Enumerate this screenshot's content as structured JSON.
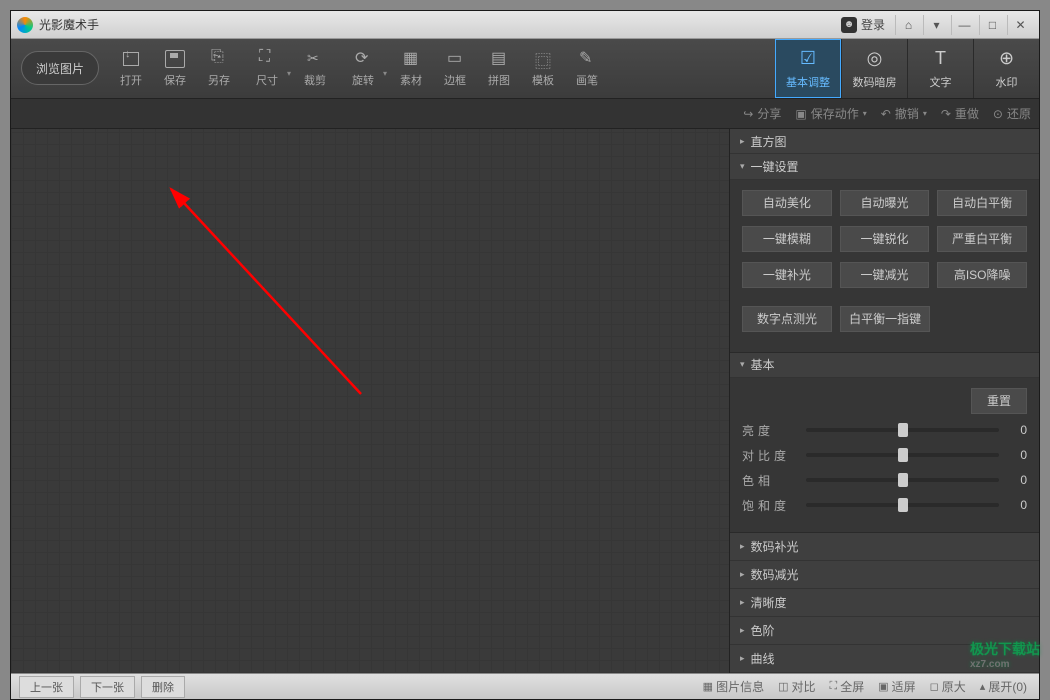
{
  "app": {
    "title": "光影魔术手"
  },
  "titlebar": {
    "login": "登录"
  },
  "toolbar": {
    "browse": "浏览图片",
    "items": [
      {
        "label": "打开",
        "icon": "open"
      },
      {
        "label": "保存",
        "icon": "save"
      },
      {
        "label": "另存",
        "icon": "saveas"
      },
      {
        "label": "尺寸",
        "icon": "size",
        "dd": true
      },
      {
        "label": "裁剪",
        "icon": "crop"
      },
      {
        "label": "旋转",
        "icon": "rotate",
        "dd": true
      },
      {
        "label": "素材",
        "icon": "material"
      },
      {
        "label": "边框",
        "icon": "border"
      },
      {
        "label": "拼图",
        "icon": "collage"
      },
      {
        "label": "模板",
        "icon": "template"
      },
      {
        "label": "画笔",
        "icon": "brush"
      }
    ]
  },
  "primary_tabs": [
    {
      "label": "基本调整",
      "icon": "☑",
      "active": true
    },
    {
      "label": "数码暗房",
      "icon": "◎"
    },
    {
      "label": "文字",
      "icon": "T"
    },
    {
      "label": "水印",
      "icon": "⊕"
    }
  ],
  "subtoolbar": {
    "share": "分享",
    "save_action": "保存动作",
    "undo": "撤销",
    "redo": "重做",
    "restore": "还原"
  },
  "right_panel": {
    "histogram": {
      "title": "直方图"
    },
    "one_click": {
      "title": "一键设置",
      "buttons_row1": [
        "自动美化",
        "自动曝光",
        "自动白平衡"
      ],
      "buttons_row2": [
        "一键模糊",
        "一键锐化",
        "严重白平衡"
      ],
      "buttons_row3": [
        "一键补光",
        "一键减光",
        "高ISO降噪"
      ],
      "buttons_row4": [
        "数字点测光",
        "白平衡一指键"
      ]
    },
    "basic": {
      "title": "基本",
      "reset": "重置",
      "sliders": [
        {
          "label": "亮度",
          "value": "0"
        },
        {
          "label": "对比度",
          "value": "0"
        },
        {
          "label": "色相",
          "value": "0"
        },
        {
          "label": "饱和度",
          "value": "0"
        }
      ]
    },
    "collapsed_sections": [
      "数码补光",
      "数码减光",
      "清晰度",
      "色阶",
      "曲线"
    ]
  },
  "statusbar": {
    "prev": "上一张",
    "next": "下一张",
    "delete": "删除",
    "image_info": "图片信息",
    "compare": "对比",
    "fullscreen": "全屏",
    "fit": "适屏",
    "original": "原大",
    "expand": "展开(0)"
  },
  "watermark": {
    "brand": "极光下载站",
    "url": "xz7.com"
  }
}
